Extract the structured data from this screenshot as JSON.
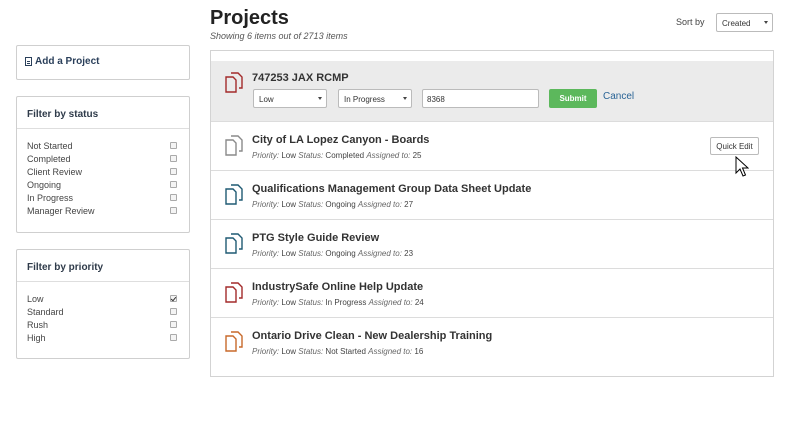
{
  "sidebar": {
    "add_project_label": "Add a Project",
    "status_filter": {
      "title": "Filter by status",
      "items": [
        {
          "label": "Not Started",
          "checked": false
        },
        {
          "label": "Completed",
          "checked": false
        },
        {
          "label": "Client Review",
          "checked": false
        },
        {
          "label": "Ongoing",
          "checked": false
        },
        {
          "label": "In Progress",
          "checked": false
        },
        {
          "label": "Manager Review",
          "checked": false
        }
      ]
    },
    "priority_filter": {
      "title": "Filter by priority",
      "items": [
        {
          "label": "Low",
          "checked": true
        },
        {
          "label": "Standard",
          "checked": false
        },
        {
          "label": "Rush",
          "checked": false
        },
        {
          "label": "High",
          "checked": false
        }
      ]
    }
  },
  "header": {
    "title": "Projects",
    "summary": "Showing 6 items out of 2713 items",
    "sort_label": "Sort by",
    "sort_value": "Created"
  },
  "edit_row": {
    "name": "747253 JAX RCMP",
    "priority_value": "Low",
    "status_value": "In Progress",
    "assigned_value": "8368",
    "submit_label": "Submit",
    "cancel_label": "Cancel",
    "icon_color": "#a32a2a"
  },
  "meta_labels": {
    "priority": "Priority:",
    "status": "Status:",
    "assigned": "Assigned to:"
  },
  "quick_edit_label": "Quick Edit",
  "projects": [
    {
      "name": "City of LA Lopez Canyon - Boards",
      "priority": "Low",
      "status": "Completed",
      "assigned": "25",
      "icon_color": "#8a8a8a"
    },
    {
      "name": "Qualifications Management Group Data Sheet Update",
      "priority": "Low",
      "status": "Ongoing",
      "assigned": "27",
      "icon_color": "#1f5a73"
    },
    {
      "name": "PTG Style Guide Review",
      "priority": "Low",
      "status": "Ongoing",
      "assigned": "23",
      "icon_color": "#1f5a73"
    },
    {
      "name": "IndustrySafe Online Help Update",
      "priority": "Low",
      "status": "In Progress",
      "assigned": "24",
      "icon_color": "#a32a2a"
    },
    {
      "name": "Ontario Drive Clean - New Dealership Training",
      "priority": "Low",
      "status": "Not Started",
      "assigned": "16",
      "icon_color": "#c8692a"
    }
  ]
}
